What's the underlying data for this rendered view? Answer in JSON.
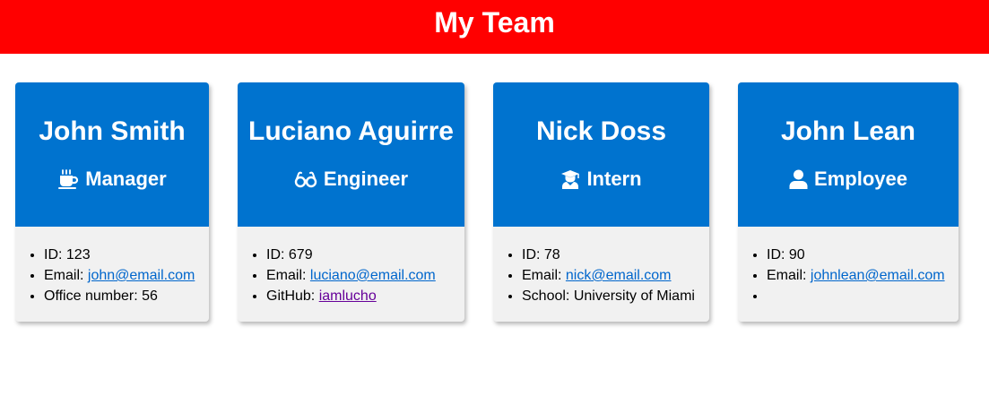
{
  "header": {
    "title": "My Team"
  },
  "cards": [
    {
      "name": "John Smith",
      "role": "Manager",
      "icon": "coffee-icon",
      "id_label": "ID: ",
      "id": "123",
      "email_label": "Email: ",
      "email": "john@email.com",
      "extra_label": "Office number: ",
      "extra": "56"
    },
    {
      "name": "Luciano Aguirre",
      "role": "Engineer",
      "icon": "glasses-icon",
      "id_label": "ID: ",
      "id": "679",
      "email_label": "Email: ",
      "email": "luciano@email.com",
      "extra_label": "GitHub: ",
      "extra": "iamlucho"
    },
    {
      "name": "Nick Doss",
      "role": "Intern",
      "icon": "graduate-icon",
      "id_label": "ID: ",
      "id": "78",
      "email_label": "Email: ",
      "email": "nick@email.com",
      "extra_label": "School: ",
      "extra": "University of Miami"
    },
    {
      "name": "John Lean",
      "role": "Employee",
      "icon": "user-icon",
      "id_label": "ID: ",
      "id": "90",
      "email_label": "Email: ",
      "email": "johnlean@email.com",
      "extra_label": "",
      "extra": ""
    }
  ],
  "colors": {
    "header_bg": "#ff0000",
    "card_header_bg": "#0073cf",
    "card_body_bg": "#f1f1f1",
    "link": "#0066cc",
    "visited_link": "#660099"
  }
}
